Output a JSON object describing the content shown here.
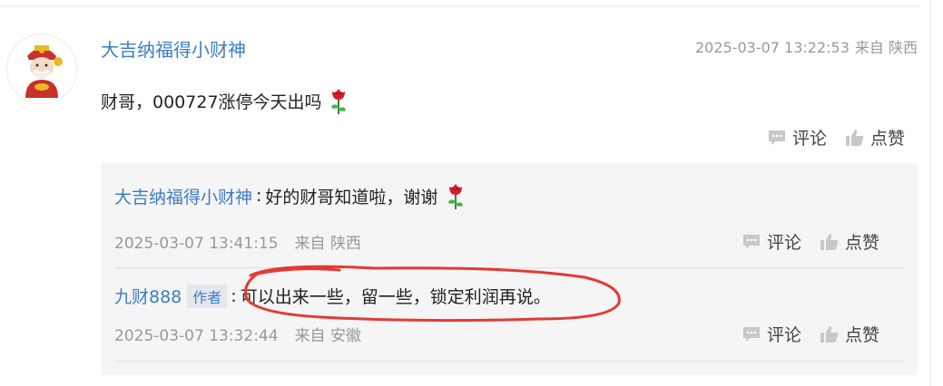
{
  "comment": {
    "author": "大吉纳福得小财神",
    "timestamp": "2025-03-07 13:22:53",
    "source": "来自 陕西",
    "text": "财哥，000727涨停今天出吗",
    "emoji": "rose-icon",
    "comment_label": "评论",
    "like_label": "点赞"
  },
  "replies": [
    {
      "author": "大吉纳福得小财神",
      "separator": ":",
      "text": "好的财哥知道啦，谢谢",
      "emoji": "rose-icon",
      "timestamp": "2025-03-07 13:41:15",
      "source": "来自 陕西",
      "comment_label": "评论",
      "like_label": "点赞"
    },
    {
      "author": "九财888",
      "badge": "作者",
      "separator": ":",
      "text": "可以出来一些，留一些，锁定利润再说。",
      "timestamp": "2025-03-07 13:32:44",
      "source": "来自 安徽",
      "comment_label": "评论",
      "like_label": "点赞"
    }
  ],
  "colors": {
    "link": "#3c7dc4",
    "meta": "#999999",
    "reply_bg": "#f5f5f5",
    "annotation": "#e53935"
  }
}
